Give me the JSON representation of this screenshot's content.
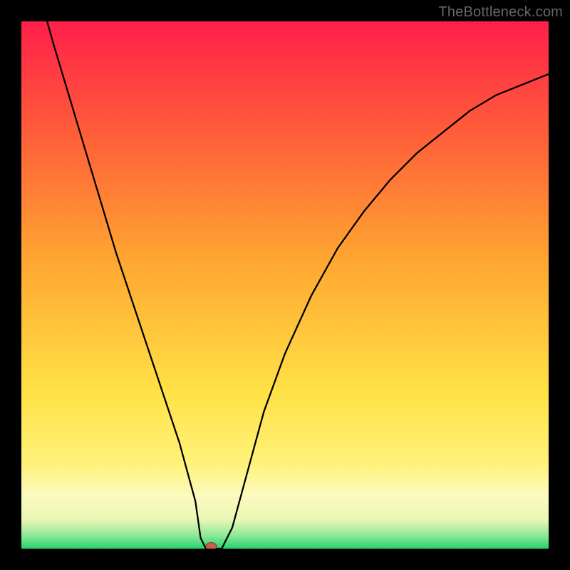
{
  "watermark": "TheBottleneck.com",
  "colors": {
    "frame": "#000000",
    "curve": "#000000",
    "marker_fill": "#c9604f",
    "marker_stroke": "#7a3b31",
    "gradient_stops": [
      {
        "offset": 0.0,
        "color": "#ff1f4a"
      },
      {
        "offset": 0.2,
        "color": "#ff5a3a"
      },
      {
        "offset": 0.45,
        "color": "#ffa531"
      },
      {
        "offset": 0.7,
        "color": "#ffe145"
      },
      {
        "offset": 0.84,
        "color": "#fff27a"
      },
      {
        "offset": 0.9,
        "color": "#fcfac0"
      },
      {
        "offset": 0.945,
        "color": "#e9f7b4"
      },
      {
        "offset": 0.975,
        "color": "#8fe89a"
      },
      {
        "offset": 1.0,
        "color": "#23d36b"
      }
    ]
  },
  "chart_data": {
    "type": "line",
    "title": "",
    "xlabel": "",
    "ylabel": "",
    "xlim": [
      0,
      100
    ],
    "ylim": [
      0,
      100
    ],
    "grid": false,
    "legend": false,
    "marker": {
      "x": 36,
      "y": 0
    },
    "series": [
      {
        "name": "bottleneck-curve",
        "x": [
          0,
          3,
          6,
          9,
          12,
          15,
          18,
          21,
          24,
          27,
          30,
          33,
          34,
          35,
          38,
          40,
          43,
          46,
          50,
          55,
          60,
          65,
          70,
          75,
          80,
          85,
          90,
          95,
          100
        ],
        "values": [
          118,
          107,
          96,
          86,
          76,
          66,
          56,
          47,
          38,
          29,
          20,
          9,
          2,
          0,
          0,
          4,
          15,
          26,
          37,
          48,
          57,
          64,
          70,
          75,
          79,
          83,
          86,
          88,
          90
        ]
      }
    ]
  }
}
